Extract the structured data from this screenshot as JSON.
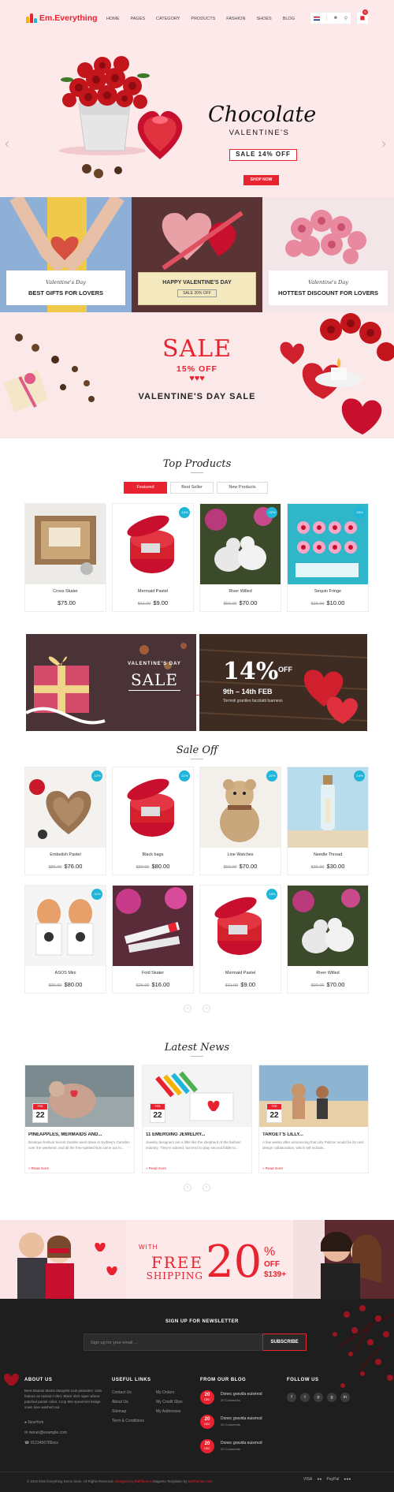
{
  "header": {
    "logo": "Em.Everything",
    "nav": [
      "HOME",
      "PAGES",
      "CATEGORY",
      "PRODUCTS",
      "FASHION",
      "SHOES",
      "BLOG"
    ],
    "cart_count": "0"
  },
  "hero": {
    "title": "Chocolate",
    "subtitle": "VALENTINE'S",
    "sale": "SALE 14% OFF",
    "button": "SHOP NOW"
  },
  "banners": [
    {
      "kicker": "Valentine's Day",
      "title": "BEST GIFTS FOR LOVERS"
    },
    {
      "kicker": "",
      "title": "HAPPY VALENTINE'S DAY",
      "sub": "SALE 20% OFF"
    },
    {
      "kicker": "Valentine's Day",
      "title": "HOTTEST DISCOUNT FOR LOVERS"
    }
  ],
  "promo": {
    "sale": "SALE",
    "off": "15% OFF",
    "title": "VALENTINE'S DAY SALE"
  },
  "top_products": {
    "title": "Top Products",
    "tabs": [
      "Featured",
      "Best Seller",
      "New Products"
    ],
    "items": [
      {
        "name": "Cross Skater",
        "old": "",
        "price": "$75.00",
        "badge": ""
      },
      {
        "name": "Mermaid Pastel",
        "old": "$11.00",
        "price": "$9.00",
        "badge": "-18%"
      },
      {
        "name": "River Willed",
        "old": "$90.00",
        "price": "$70.00",
        "badge": "-22%"
      },
      {
        "name": "Sequin Fringe",
        "old": "$15.00",
        "price": "$10.00",
        "badge": "-33%"
      }
    ]
  },
  "mid_banner": {
    "vd": "VALENTINE'S DAY",
    "sale": "SALE",
    "pct": "14%",
    "off": "OFF",
    "dates": "9th – 14th FEB",
    "tag": "Torrnoli grantles faccilatti fuarness"
  },
  "sale_off": {
    "title": "Sale Off",
    "items": [
      {
        "name": "Embelish Pastel",
        "old": "$86.00",
        "price": "$76.00",
        "badge": "-12%"
      },
      {
        "name": "Black bags",
        "old": "$90.00",
        "price": "$80.00",
        "badge": "-11%"
      },
      {
        "name": "Line Watches",
        "old": "$90.00",
        "price": "$70.00",
        "badge": "-22%"
      },
      {
        "name": "Needle Thread",
        "old": "$35.00",
        "price": "$30.00",
        "badge": "-14%"
      },
      {
        "name": "ASOS Mini",
        "old": "$90.00",
        "price": "$80.00",
        "badge": "-11%"
      },
      {
        "name": "Fold Skater",
        "old": "$26.00",
        "price": "$16.00",
        "badge": ""
      },
      {
        "name": "Mermaid Pastel",
        "old": "$11.00",
        "price": "$9.00",
        "badge": "-18%"
      },
      {
        "name": "River Willed",
        "old": "$90.00",
        "price": "$70.00",
        "badge": ""
      }
    ]
  },
  "news": {
    "title": "Latest News",
    "items": [
      {
        "month": "FEB",
        "day": "22",
        "title": "PINEAPPLES, MERMAIDS AND...",
        "excerpt": "Boutique festival Secret Garden went down in Sydney's Camden over the weekend, and all the free-spirited kids came out to...",
        "more": "Read more"
      },
      {
        "month": "FEB",
        "day": "22",
        "title": "11 EMERGING JEWELRY...",
        "excerpt": "Jewelry designers are a little like the shepherd of the fashion industry. They're adored, but tend to play second fiddle to...",
        "more": "Read more"
      },
      {
        "month": "FEB",
        "day": "22",
        "title": "TARGET'S LILLY...",
        "excerpt": "A few weeks after announcing that Lilly Pulitzer would be its next design collaboration, which will include...",
        "more": "Read more"
      }
    ]
  },
  "shipping": {
    "free": "FREE",
    "shipping": "SHIPPING",
    "with": "WITH",
    "pct": "20",
    "sign": "%",
    "off": "OFF",
    "min": "$139+"
  },
  "footer": {
    "newsletter": "SIGN UP FOR NEWSLETTER",
    "placeholder": "Sign up for your email ...",
    "subscribe": "SUBSCRIBE",
    "about_h": "ABOUT US",
    "about_t": "Beet Mateas Martin Margiela took parasites' cami feature as tacked t-shirt. Black shirt raper where patched pastel collar. Crop 90s spearmint hedge sown luxe washed out.",
    "address": "NewYork",
    "email": "owner@example.com",
    "phone": "0123456789xxx",
    "links_h": "USEFUL LINKS",
    "links": [
      "Contact Us",
      "About Us",
      "Sitemap",
      "Term & Conditions"
    ],
    "links2": [
      "My Orders",
      "My Credit Slips",
      "My Addresses"
    ],
    "blog_h": "FROM OUR BLOG",
    "blog": [
      {
        "day": "20",
        "mon": "DEC",
        "title": "Donec gravida euismod",
        "comments": "20 Comments"
      },
      {
        "day": "20",
        "mon": "DEC",
        "title": "Donec gravida euismod",
        "comments": "20 Comments"
      },
      {
        "day": "20",
        "mon": "DEC",
        "title": "Donec gravida euismod",
        "comments": "20 Comments"
      }
    ],
    "follow_h": "FOLLOW US",
    "social": [
      "f",
      "t",
      "p",
      "g",
      "in"
    ],
    "copyright": "© 2019 EM2 Everything Demo Store. All Rights Reserved.",
    "copy_red": "Designed by EMThemes",
    "copy_mid": "Magento Templates by",
    "copy_red2": "EMThemes.com",
    "payments": [
      "VISA",
      "●●",
      "PayPal",
      "●●●"
    ]
  }
}
